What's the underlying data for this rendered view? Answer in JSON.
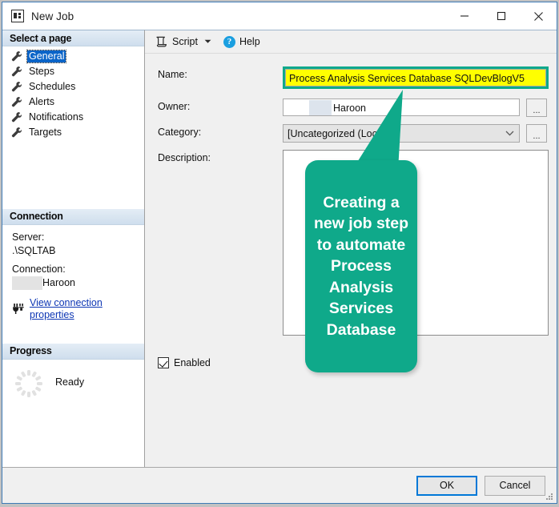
{
  "window": {
    "title": "New Job",
    "icon": "window-app-icon",
    "controls": {
      "minimize": "minimize-icon",
      "maximize": "maximize-icon",
      "close": "close-icon"
    }
  },
  "sidebar": {
    "header": "Select a page",
    "items": [
      {
        "label": "General",
        "icon": "wrench-icon",
        "selected": true
      },
      {
        "label": "Steps",
        "icon": "wrench-icon",
        "selected": false
      },
      {
        "label": "Schedules",
        "icon": "wrench-icon",
        "selected": false
      },
      {
        "label": "Alerts",
        "icon": "wrench-icon",
        "selected": false
      },
      {
        "label": "Notifications",
        "icon": "wrench-icon",
        "selected": false
      },
      {
        "label": "Targets",
        "icon": "wrench-icon",
        "selected": false
      }
    ],
    "connection": {
      "header": "Connection",
      "server_label": "Server:",
      "server_value": ".\\SQLTAB",
      "connection_label": "Connection:",
      "connection_value": "Haroon",
      "link": "View connection properties",
      "link_icon": "connection-plug-icon"
    },
    "progress": {
      "header": "Progress",
      "status": "Ready",
      "spinner_icon": "progress-spinner-icon"
    }
  },
  "toolbar": {
    "script_label": "Script",
    "script_icon": "script-icon",
    "dropdown_icon": "chevron-down-icon",
    "help_label": "Help",
    "help_icon": "help-question-icon"
  },
  "form": {
    "name_label": "Name:",
    "name_value": "Process Analysis Services Database SQLDevBlogV5",
    "owner_label": "Owner:",
    "owner_value": "Haroon",
    "category_label": "Category:",
    "category_value": "[Uncategorized (Local)]",
    "description_label": "Description:",
    "description_value": "",
    "enabled_label": "Enabled",
    "enabled_checked": true,
    "browse_button_label": "...",
    "combo_arrow_icon": "chevron-down-icon"
  },
  "footer": {
    "ok_label": "OK",
    "cancel_label": "Cancel",
    "resize_grip_icon": "resize-grip-icon"
  },
  "annotation": {
    "text": "Creating a new job step to automate Process Analysis Services Database",
    "color": "#0fa98a",
    "text_color": "#ffffff"
  },
  "colors": {
    "highlight_field": "#ffff00",
    "accent_green": "#0fa98a",
    "selection_blue": "#0a64c8",
    "link_blue": "#0d36b4",
    "window_border": "#3e7bb6"
  }
}
